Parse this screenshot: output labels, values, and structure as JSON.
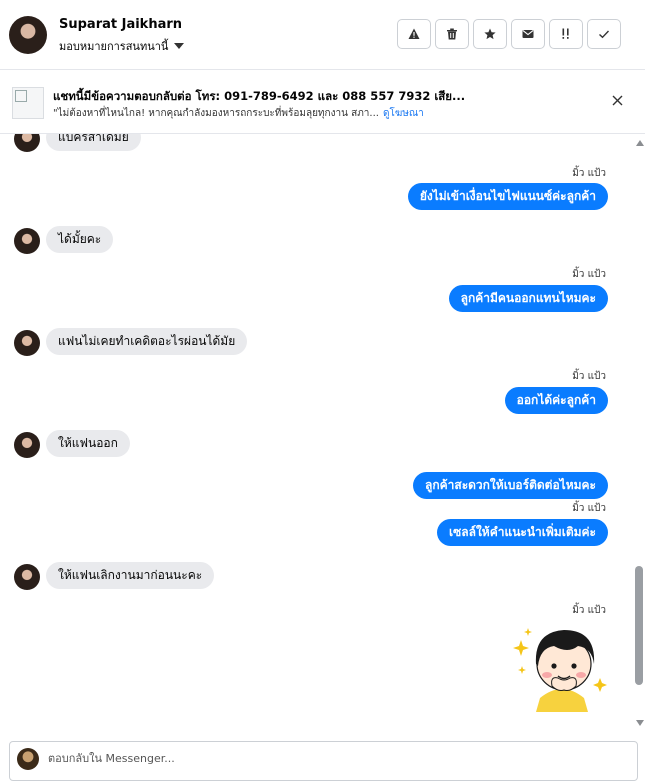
{
  "header": {
    "name": "Suparat Jaikharn",
    "assign_label": "มอบหมายการสนทนานี้",
    "actions": [
      "spam-icon",
      "delete-icon",
      "star-icon",
      "mail-icon",
      "follow-up-icon",
      "done-icon"
    ]
  },
  "ad": {
    "title": "แชทนี้มีข้อความตอบกลับต่อ โทร: 091-789-6492 และ 088 557 7932 เสีย...",
    "subtitle": "\"ไม่ต้องหาที่ไหนไกล! หากคุณกำลังมองหารถกระบะที่พร้อมลุยทุกงาน สภา...",
    "link": "ดูโฆษณา"
  },
  "messages": [
    {
      "dir": "in",
      "text": "แบครสาเดมย"
    },
    {
      "dir": "out",
      "seen": "มิ้ว แป้ว",
      "text": "ยังไม่เข้าเงื่อนไขไฟแนนซ์ค่ะลูกค้า"
    },
    {
      "dir": "in",
      "text": "ได้มั้ยคะ"
    },
    {
      "dir": "out",
      "seen": "มิ้ว แป้ว",
      "text": "ลูกค้ามีคนออกแทนไหมคะ"
    },
    {
      "dir": "in",
      "text": "แฟนไม่เคยทำเคดิตอะไรผ่อนได้มัย"
    },
    {
      "dir": "out",
      "seen": "มิ้ว แป้ว",
      "text": "ออกได้ค่ะลูกค้า"
    },
    {
      "dir": "in",
      "text": "ให้แฟนออก"
    },
    {
      "dir": "out",
      "text": "ลูกค้าสะดวกให้เบอร์ติดต่อไหมคะ"
    },
    {
      "dir": "out",
      "seen": "มิ้ว แป้ว",
      "text": "เซลล์ให้คำแนะนำเพิ่มเติมค่ะ"
    },
    {
      "dir": "in",
      "text": "ให้แฟนเลิกงานมาก่อนนะคะ"
    },
    {
      "dir": "out",
      "seen": "มิ้ว แป้ว",
      "text": ""
    }
  ],
  "composer": {
    "placeholder": "ตอบกลับใน Messenger..."
  },
  "colors": {
    "outgoing_bubble": "#0a7cff",
    "incoming_bubble": "#e9eaed"
  }
}
